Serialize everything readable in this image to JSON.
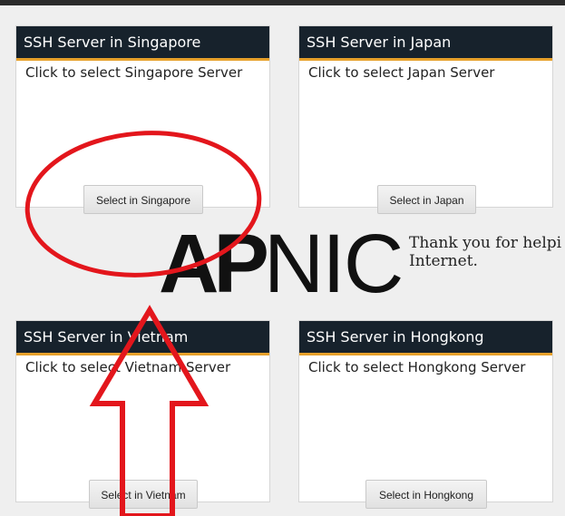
{
  "cards": [
    {
      "title": "SSH Server in Singapore",
      "description": "Click to select Singapore Server",
      "button": "Select in Singapore"
    },
    {
      "title": "SSH Server in Japan",
      "description": "Click to select Japan Server",
      "button": "Select in Japan"
    },
    {
      "title": "SSH Server in Vietnam",
      "description": "Click to select Vietnam Server",
      "button": "Select in Vietnam"
    },
    {
      "title": "SSH Server in Hongkong",
      "description": "Click to select Hongkong Server",
      "button": "Select in Hongkong"
    }
  ],
  "background_banner": {
    "logo_bold": "AP",
    "logo_thin": "NIC",
    "text_line1": "Thank you for helpi",
    "text_line2": "Internet."
  },
  "annotations": {
    "highlight_color": "#e3161c",
    "circle_shape": "red-ellipse",
    "arrow_shape": "red-up-arrow"
  },
  "colors": {
    "header_bg": "#17222c",
    "header_accent": "#e7a12b",
    "page_bg": "#efefef"
  }
}
